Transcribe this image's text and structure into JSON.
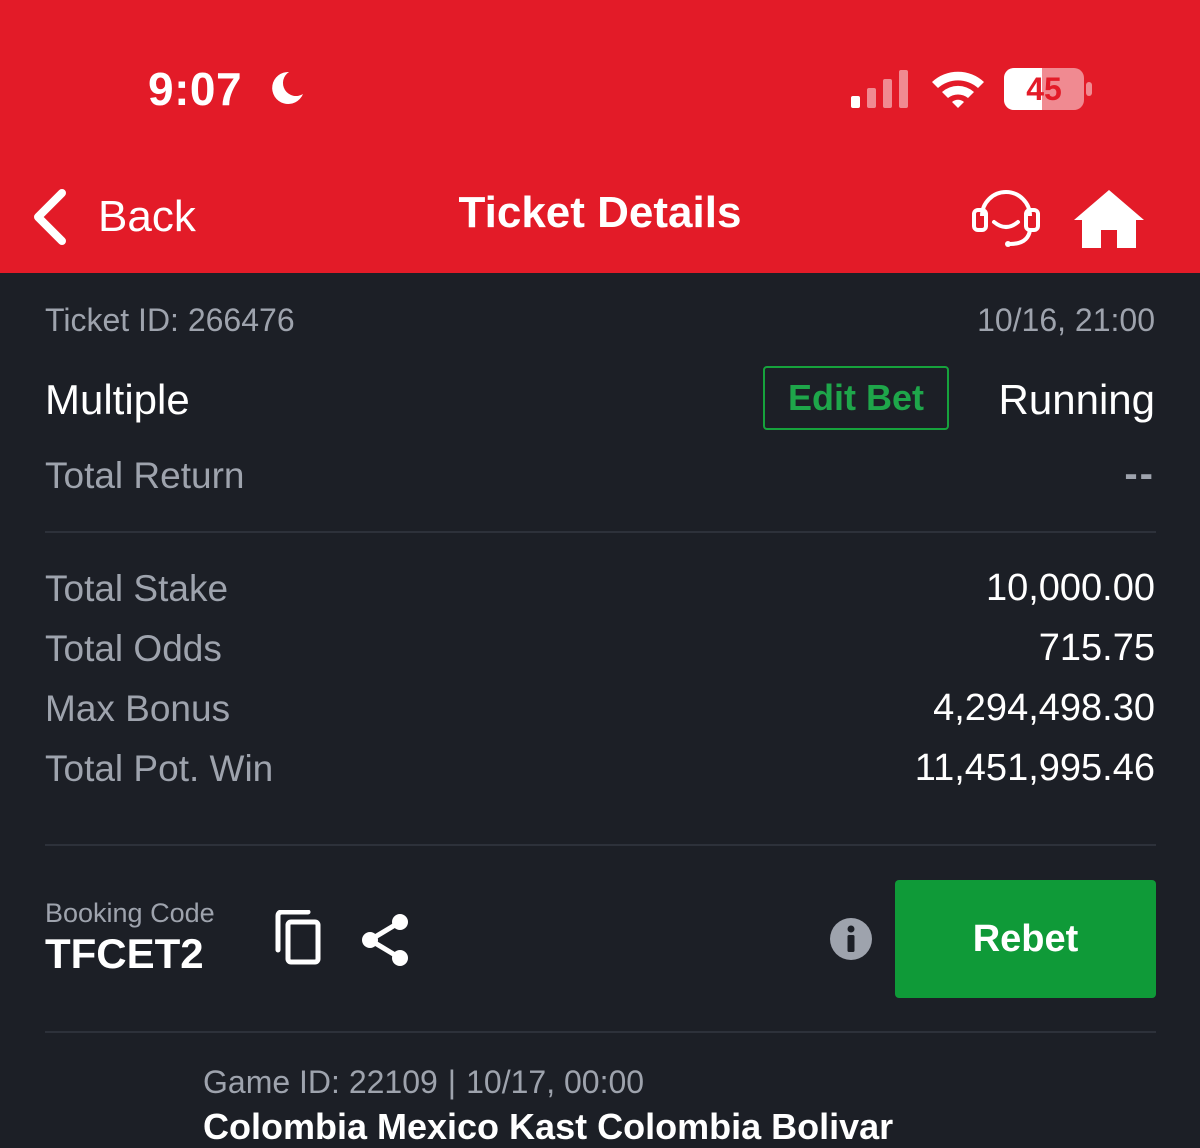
{
  "status_bar": {
    "time": "9:07",
    "battery": "45"
  },
  "nav": {
    "back_label": "Back",
    "title": "Ticket Details"
  },
  "ticket": {
    "id_text": "Ticket ID: 266476",
    "date": "10/16, 21:00",
    "bet_type": "Multiple",
    "edit_bet_label": "Edit Bet",
    "status": "Running",
    "total_return_label": "Total Return",
    "total_return_value": "--"
  },
  "stats": [
    {
      "label": "Total Stake",
      "value": "10,000.00"
    },
    {
      "label": "Total Odds",
      "value": "715.75"
    },
    {
      "label": "Max Bonus",
      "value": "4,294,498.30"
    },
    {
      "label": "Total Pot. Win",
      "value": "11,451,995.46"
    }
  ],
  "booking": {
    "label": "Booking Code",
    "code": "TFCET2",
    "rebet_label": "Rebet"
  },
  "game": {
    "id_text": "Game ID: 22109",
    "separator": "|",
    "date": "10/17, 00:00",
    "match": "Colombia Mexico Kast Colombia Bolivar"
  },
  "colors": {
    "header": "#e31b28",
    "background": "#1c1f26",
    "accent_green": "#0f9a38",
    "muted_text": "#9ea3ad"
  },
  "icons": [
    "moon-icon",
    "signal-icon",
    "wifi-icon",
    "battery-icon",
    "chevron-left-icon",
    "headset-icon",
    "home-icon",
    "copy-icon",
    "share-icon",
    "info-icon"
  ]
}
